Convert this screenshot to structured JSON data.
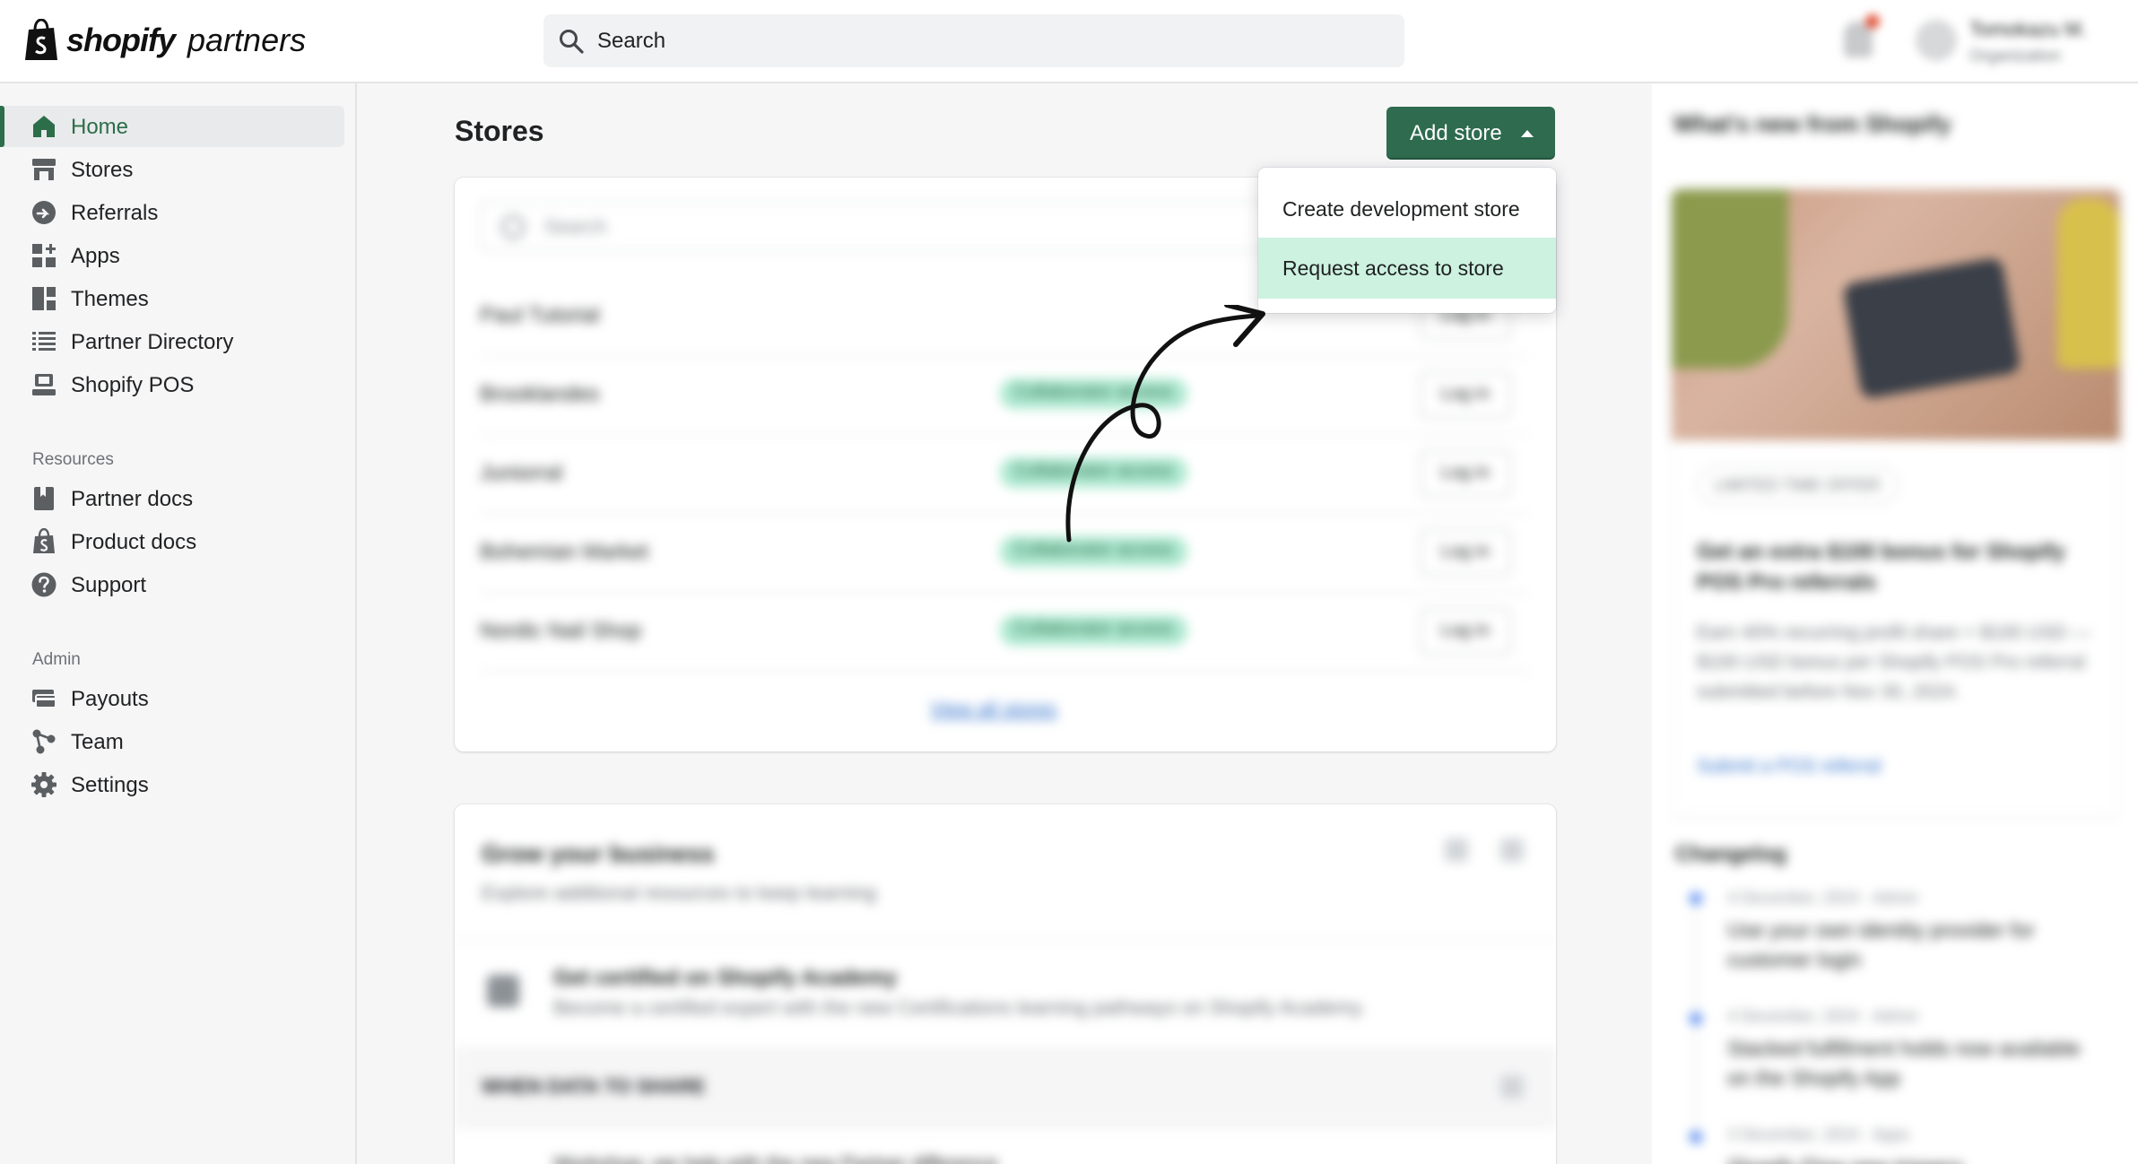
{
  "topbar": {
    "logo_word": "shopify",
    "logo_sub": "partners",
    "search_placeholder": "Search",
    "user_name": "Tomokazu M.",
    "user_org": "Organization"
  },
  "sidebar": {
    "items": [
      {
        "label": "Home",
        "icon": "home-icon",
        "active": true
      },
      {
        "label": "Stores",
        "icon": "store-icon"
      },
      {
        "label": "Referrals",
        "icon": "referral-icon"
      },
      {
        "label": "Apps",
        "icon": "apps-icon"
      },
      {
        "label": "Themes",
        "icon": "themes-icon"
      },
      {
        "label": "Partner Directory",
        "icon": "list-icon"
      },
      {
        "label": "Shopify POS",
        "icon": "pos-icon"
      }
    ],
    "resources_heading": "Resources",
    "resources": [
      {
        "label": "Partner docs",
        "icon": "book-icon"
      },
      {
        "label": "Product docs",
        "icon": "shopify-bag-icon"
      },
      {
        "label": "Support",
        "icon": "question-icon"
      }
    ],
    "admin_heading": "Admin",
    "admin": [
      {
        "label": "Payouts",
        "icon": "payouts-icon"
      },
      {
        "label": "Team",
        "icon": "team-icon"
      },
      {
        "label": "Settings",
        "icon": "gear-icon"
      }
    ]
  },
  "main": {
    "title": "Stores",
    "add_store_label": "Add store",
    "dropdown": {
      "items": [
        {
          "label": "Create development store",
          "highlighted": false
        },
        {
          "label": "Request access to store",
          "highlighted": true
        }
      ]
    },
    "stores_card": {
      "search_placeholder": "Search",
      "rows": [
        {
          "name": "Paul Tutorial",
          "badge": "",
          "action": "Log in"
        },
        {
          "name": "Brooklandes",
          "badge": "Collaborator access",
          "action": "Log in"
        },
        {
          "name": "Juniorral",
          "badge": "Collaborator access",
          "action": "Log in"
        },
        {
          "name": "Bohemian Market",
          "badge": "Collaborator access",
          "action": "Log in"
        },
        {
          "name": "Nordic Nail Shop",
          "badge": "Collaborator access",
          "action": "Log in"
        }
      ],
      "view_all": "View all stores"
    },
    "grow_card": {
      "title": "Grow your business",
      "subtitle": "Explore additional resources to keep learning",
      "item_title": "Get certified on Shopify Academy",
      "item_desc": "Become a certified expert with the new Certifications learning pathways on Shopify Academy.",
      "band_label": "WHEN DATA TO SHARE",
      "footer_text": "Workshop: we help with the new Partner difference"
    }
  },
  "right_panel": {
    "title": "What's new from Shopify",
    "card": {
      "badge": "LIMITED TIME OFFER",
      "heading": "Get an extra $100 bonus for Shopify POS Pro referrals",
      "body": "Earn 40% recurring profit share + $100 USD — $100 USD bonus per Shopify POS Pro referral submitted before Nov 30, 2024.",
      "link": "Submit a POS referral"
    },
    "changelog_title": "Changelog",
    "changelog": [
      {
        "date": "4 December, 2024 · Admin",
        "title": "Use your own identity provider for customer login"
      },
      {
        "date": "4 December, 2024 · Admin",
        "title": "Stacked fulfillment holds now available on the Shopify App"
      },
      {
        "date": "3 December, 2024 · Apps",
        "title": "Shopify Flow new triggers"
      }
    ]
  },
  "colors": {
    "brand_green": "#2e6b4f",
    "highlight_green": "#cdf2e0",
    "link_blue": "#2c6ecb"
  }
}
